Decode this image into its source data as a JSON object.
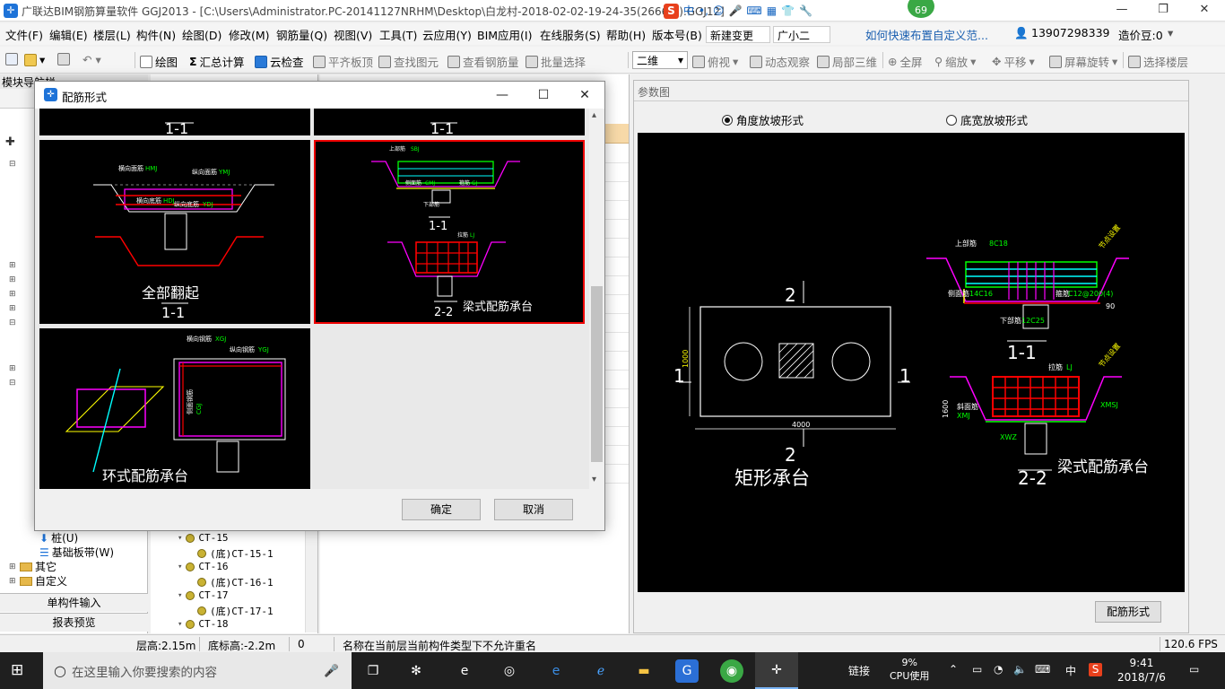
{
  "app": {
    "title": "广联达BIM钢筋算量软件 GGJ2013 - [C:\\Users\\Administrator.PC-20141127NRHM\\Desktop\\白龙村-2018-02-02-19-24-35(2666版).GGJ12]",
    "badge": "69",
    "ime_label": "中"
  },
  "menu": {
    "items": [
      "文件(F)",
      "编辑(E)",
      "楼层(L)",
      "构件(N)",
      "绘图(D)",
      "修改(M)",
      "钢筋量(Q)",
      "视图(V)",
      "工具(T)",
      "云应用(Y)",
      "BIM应用(I)",
      "在线服务(S)",
      "帮助(H)",
      "版本号(B)"
    ],
    "new_change": "新建变更",
    "xiaoguang": "广小二",
    "tip_link": "如何快速布置自定义范...",
    "phone": "13907298339",
    "price_bean": "造价豆:0"
  },
  "toolbar": {
    "draw": "绘图",
    "sum": "汇总计算",
    "cloud_check": "云检查",
    "flat_top": "平齐板顶",
    "find_elem": "查找图元",
    "view_rebar": "查看钢筋量",
    "batch_select": "批量选择",
    "view_mode": "二维",
    "top_view": "俯视",
    "dynamic_view": "动态观察",
    "local_3d": "局部三维",
    "fullscreen": "全屏",
    "zoom": "缩放",
    "pan": "平移",
    "rotate": "屏幕旋转",
    "select_floor": "选择楼层"
  },
  "nav": {
    "title": "模块导航栏",
    "items": [
      "桩(U)",
      "基础板带(W)",
      "其它",
      "自定义"
    ],
    "single_input": "单构件输入",
    "report_preview": "报表预览"
  },
  "component_list": {
    "rows": [
      "CT-15",
      "(底)CT-15-1",
      "CT-16",
      "(底)CT-16-1",
      "CT-17",
      "(底)CT-17-1",
      "CT-18"
    ]
  },
  "param_panel": {
    "header": "参数图",
    "radio_angle": "角度放坡形式",
    "radio_width": "底宽放坡形式",
    "button": "配筋形式",
    "diagram": {
      "plan_title": "矩形承台",
      "dim_width": "4000",
      "dim_height": "1000",
      "sec1_label": "1-1",
      "sec2_label": "2-2",
      "beam_title": "梁式配筋承台",
      "cut1": "1",
      "cut2": "2",
      "top_bar": "上部筋",
      "top_bar_val": "8C18",
      "side_bar": "侧面筋",
      "side_bar_val": "14C16",
      "stirrup": "箍筋",
      "stirrup_val": "C12@200(4)",
      "bottom_bar": "下部筋",
      "bottom_bar_val": "12C25",
      "tie_bar": "拉筋",
      "tie_bar_val": "LJ",
      "slope_bar": "斜面筋",
      "slope_bar_val": "XMJ",
      "slope_bar2": "XMSJ",
      "depth": "1600",
      "angle": "90",
      "bottom_code": "XWZ",
      "slope_text": "节点设置"
    }
  },
  "dialog": {
    "title": "配筋形式",
    "ok": "确定",
    "cancel": "取消",
    "sec_label": "1-1",
    "cell_full": "全部翻起",
    "cell_beam": "梁式配筋承台",
    "cell_ring": "环式配筋承台",
    "sec_label2": "2-2",
    "lbl_horizontal": "横向面筋",
    "lbl_horizontal_code": "HMJ",
    "lbl_longitudinal": "纵向面筋",
    "lbl_longitudinal_code": "YMJ",
    "lbl_h_bottom": "横向底筋",
    "lbl_h_bottom_code": "HDJ",
    "lbl_l_bottom": "纵向底筋",
    "lbl_l_bottom_code": "YDJ",
    "lbl_top": "上部筋",
    "lbl_top_code": "SBJ",
    "lbl_side": "侧面筋",
    "lbl_side_code": "CMJ",
    "lbl_stirrup": "箍筋",
    "lbl_stirrup_code": "GJ",
    "lbl_bottom": "下部筋",
    "lbl_tie": "拉筋",
    "lbl_tie_code": "LJ",
    "lbl_xgj": "横向钢筋",
    "lbl_xgj_code": "XGJ",
    "lbl_ygj": "纵向钢筋",
    "lbl_ygj_code": "YGJ",
    "lbl_cgj": "侧面钢筋",
    "lbl_cgj_code": "CGJ"
  },
  "status": {
    "floor_height": "层高:2.15m",
    "base_height": "底标高:-2.2m",
    "zero": "0",
    "message": "名称在当前层当前构件类型下不允许重名",
    "fps": "120.6 FPS"
  },
  "taskbar": {
    "search_placeholder": "在这里输入你要搜索的内容",
    "link": "链接",
    "cpu_pct": "9%",
    "cpu_label": "CPU使用",
    "lang": "中",
    "time": "9:41",
    "date": "2018/7/6"
  }
}
